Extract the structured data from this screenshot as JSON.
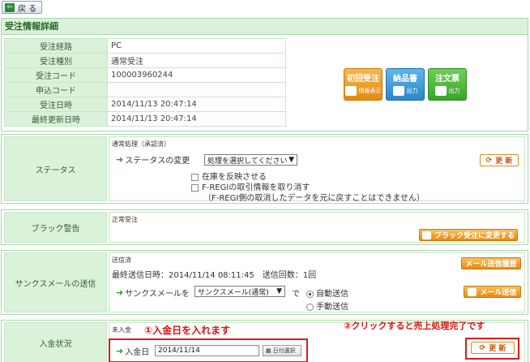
{
  "topbar": {
    "back_label": "戻 る"
  },
  "order": {
    "title": "受注情報詳細",
    "rows": [
      {
        "label": "受注経路",
        "value": "PC"
      },
      {
        "label": "受注種別",
        "value": "通常受注"
      },
      {
        "label": "受注コード",
        "value": "100003960244"
      },
      {
        "label": "申込コード",
        "value": ""
      },
      {
        "label": "受注日時",
        "value": "2014/11/13 20:47:14"
      },
      {
        "label": "最終更新日時",
        "value": "2014/11/13 20:47:14"
      }
    ],
    "buttons": [
      {
        "top": "初回受注",
        "sub": "情報表示"
      },
      {
        "top": "納品書",
        "sub": "出力"
      },
      {
        "top": "注文票",
        "sub": "出力"
      }
    ]
  },
  "status": {
    "label": "ステータス",
    "note": "通常処理（承認済）",
    "change_label": "ステータスの変更",
    "select_value": "処理を選択してください",
    "update_button": "更 新",
    "stock_checkbox": "在庫を反映させる",
    "fregi_checkbox": "F-REGIの取引情報を取り消す",
    "fregi_note": "（F-REGI側の取消したデータを元に戻すことはできません）"
  },
  "blacklist": {
    "label": "ブラック警告",
    "status": "正常受注",
    "change_button": "ブラック受注に変更する"
  },
  "thanks": {
    "label": "サンクスメールの送信",
    "status": "送信済",
    "last_sent": "最終送信日時：2014/11/14 08:11:45　送信回数：1回",
    "history_button": "メール送信履歴",
    "mail_prefix": "サンクスメールを",
    "select_value": "サンクスメール(通常)",
    "mail_suffix": "で",
    "radio_auto": "自動送信",
    "radio_manual": "手動送信",
    "send_button": "メール送信"
  },
  "payment": {
    "label": "入金状況",
    "status": "未入金",
    "annotation1": "①入金日を入れます",
    "annotation2": "②クリックすると売上処理完了です",
    "date_label": "入金日",
    "date_value": "2014/11/14",
    "date_button": "日付選択",
    "update_button": "更 新"
  },
  "colors": {
    "section_border": "#a8d8a8",
    "label_bg": "#d9f2d9",
    "accent_orange": "#e88a10",
    "annotation_red": "#e01010"
  }
}
